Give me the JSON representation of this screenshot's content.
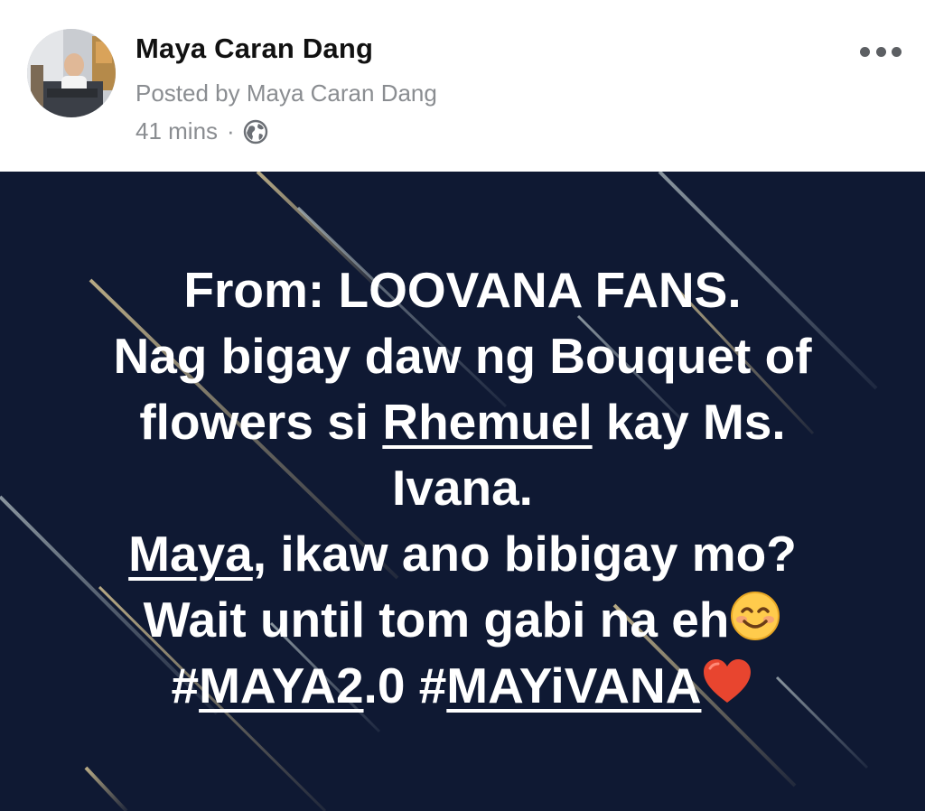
{
  "header": {
    "author": "Maya Caran Dang",
    "posted_by": "Posted by Maya Caran Dang",
    "time": "41 mins",
    "separator": "·",
    "audience_icon": "globe-icon",
    "more_icon": "more-options-icon"
  },
  "post": {
    "background_color": "#0f1933",
    "lines": {
      "l1": "From: LOOVANA FANS.",
      "l2": "Nag bigay daw ng Bouquet of",
      "l3_a": "flowers si ",
      "l3_link": "Rhemuel",
      "l3_b": " kay Ms.",
      "l4": "Ivana.",
      "l5_link": "Maya",
      "l5_b": ", ikaw ano bibigay mo?",
      "l6": "Wait until tom gabi na eh",
      "l7_hash1": "#",
      "l7_link1": "MAYA2",
      "l7_mid": ".0 #",
      "l7_link2": "MAYiVANA"
    },
    "emoji_smile": "smiling-face-emoji",
    "emoji_heart": "red-heart-emoji"
  }
}
